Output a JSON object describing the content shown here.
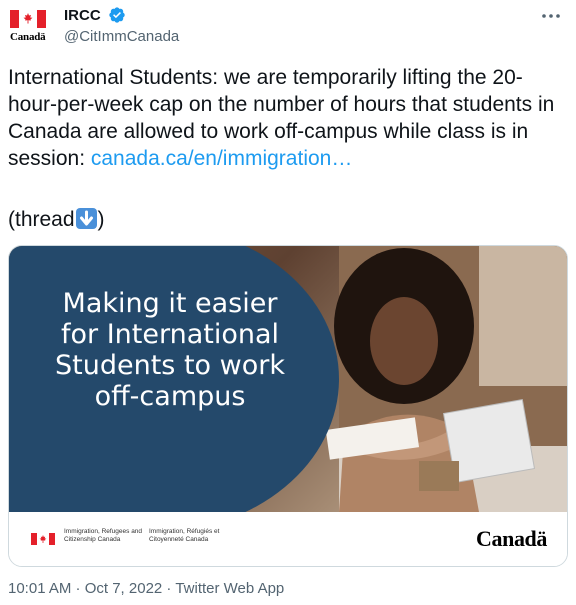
{
  "author": {
    "display_name": "IRCC",
    "handle": "@CitImmCanada",
    "avatar_wordmark": "Canadä"
  },
  "tweet": {
    "text": "International Students: we are temporarily lifting the 20-hour-per-week cap on the number of hours that students in Canada are allowed to work off-campus while class is in session: ",
    "link": "canada.ca/en/immigration…",
    "thread_prefix": "(thread",
    "thread_suffix": ")"
  },
  "media": {
    "headline": "Making it easier for International Students to work off-campus",
    "dept_en": "Immigration, Refugees and Citizenship Canada",
    "dept_fr": "Immigration, Réfugiés et Citoyenneté Canada",
    "wordmark": "Canadä"
  },
  "meta": {
    "timestamp": "10:01 AM · Oct 7, 2022 · Twitter Web App"
  },
  "colors": {
    "link": "#1d9bf0",
    "verified": "#1d9bf0",
    "panel": "#24496b",
    "flag_red": "#e4202a"
  }
}
